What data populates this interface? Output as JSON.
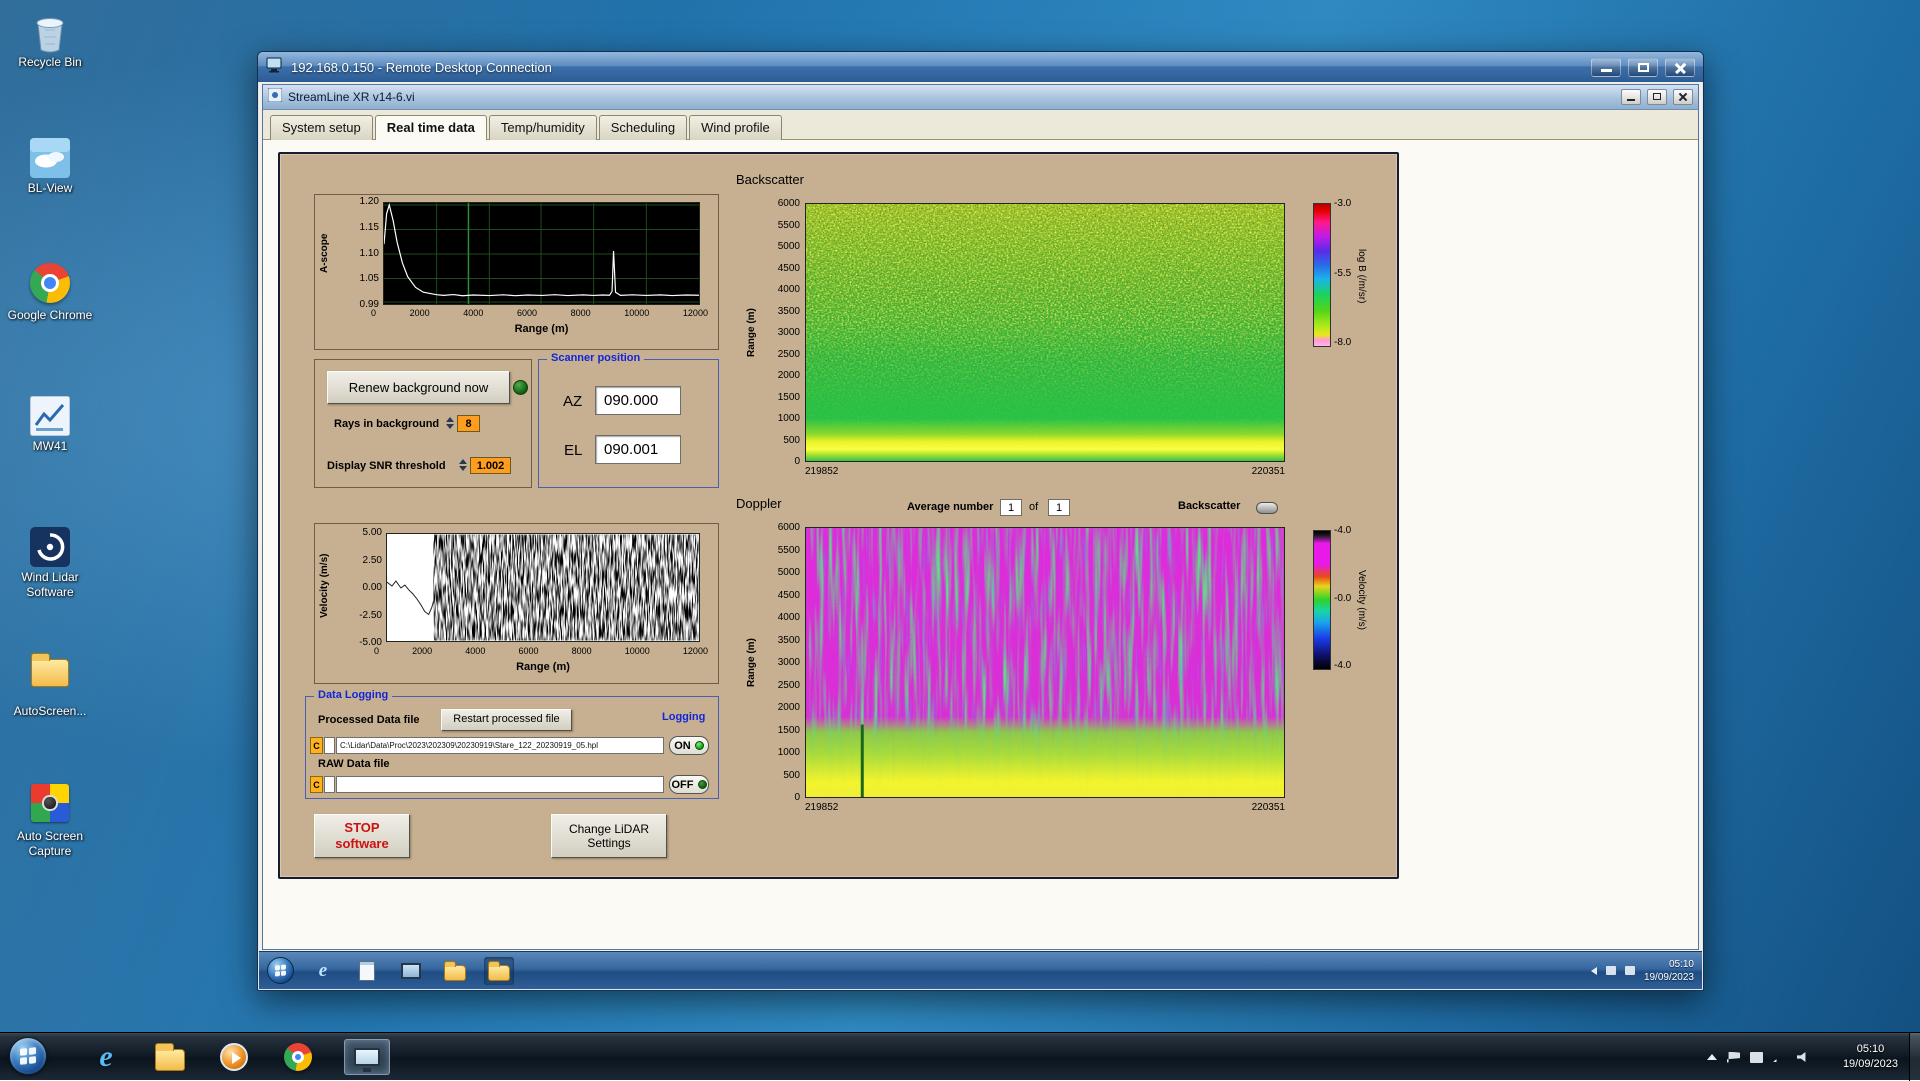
{
  "host": {
    "desktop_icons": [
      {
        "label": "Recycle Bin"
      },
      {
        "label": "BL-View"
      },
      {
        "label": "Google Chrome"
      },
      {
        "label": "MW41"
      },
      {
        "label": "Wind Lidar Software"
      },
      {
        "label": "AutoScreen..."
      },
      {
        "label": "Auto Screen Capture"
      }
    ],
    "taskbar": {
      "ie_glyph": "e",
      "time": "05:10",
      "date": "19/09/2023"
    }
  },
  "rdp": {
    "title": "192.168.0.150 - Remote Desktop Connection",
    "remote_taskbar": {
      "ie_glyph": "e",
      "time": "05:10",
      "date": "19/09/2023"
    }
  },
  "app": {
    "title": "StreamLine XR v14-6.vi",
    "tabs": [
      "System setup",
      "Real time data",
      "Temp/humidity",
      "Scheduling",
      "Wind profile"
    ],
    "ascope": {
      "ylabel": "A-scope",
      "yticks": [
        "1.20",
        "1.15",
        "1.10",
        "1.05",
        "0.99"
      ],
      "xticks": [
        "0",
        "2000",
        "4000",
        "6000",
        "8000",
        "10000",
        "12000"
      ],
      "xlabel": "Range (m)"
    },
    "background": {
      "renew_button": "Renew background now",
      "rays_label": "Rays in background",
      "rays_value": "8",
      "snr_label": "Display SNR threshold",
      "snr_value": "1.002"
    },
    "scanner": {
      "title": "Scanner position",
      "az_label": "AZ",
      "az_value": "090.000",
      "el_label": "EL",
      "el_value": "090.001"
    },
    "backscatter": {
      "title": "Backscatter",
      "ylabel": "Range (m)",
      "yticks": [
        "6000",
        "5500",
        "5000",
        "4500",
        "4000",
        "3500",
        "3000",
        "2500",
        "2000",
        "1500",
        "1000",
        "500",
        "0"
      ],
      "x_start": "219852",
      "x_end": "220351",
      "colorbar_label": "log B (/m/sr)",
      "colorbar_ticks": [
        "-3.0",
        "-5.5",
        "-8.0"
      ]
    },
    "doppler": {
      "title": "Doppler",
      "average_label": "Average number",
      "average_value": "1",
      "of_label": "of",
      "total_value": "1",
      "toggle_label": "Backscatter",
      "ylabel": "Range (m)",
      "yticks": [
        "6000",
        "5500",
        "5000",
        "4500",
        "4000",
        "3500",
        "3000",
        "2500",
        "2000",
        "1500",
        "1000",
        "500",
        "0"
      ],
      "x_start": "219852",
      "x_end": "220351",
      "colorbar_label": "Velocity (m/s)",
      "colorbar_ticks": [
        "-4.0",
        "-0.0",
        "-4.0"
      ]
    },
    "velocity": {
      "ylabel": "Velocity (m/s)",
      "yticks": [
        "5.00",
        "2.50",
        "0.00",
        "-2.50",
        "-5.00"
      ],
      "xticks": [
        "0",
        "2000",
        "4000",
        "6000",
        "8000",
        "10000",
        "12000"
      ],
      "xlabel": "Range (m)"
    },
    "logging": {
      "title": "Data Logging",
      "processed_label": "Processed Data file",
      "restart_button": "Restart processed file",
      "logging_label": "Logging",
      "drive_badge": "C",
      "processed_path": "C:\\Lidar\\Data\\Proc\\2023\\202309\\20230919\\Stare_122_20230919_05.hpl",
      "on_label": "ON",
      "raw_label": "RAW Data file",
      "raw_path": "",
      "off_label": "OFF"
    },
    "stop_line1": "STOP",
    "stop_line2": "software",
    "change_line1": "Change LiDAR",
    "change_line2": "Settings"
  }
}
